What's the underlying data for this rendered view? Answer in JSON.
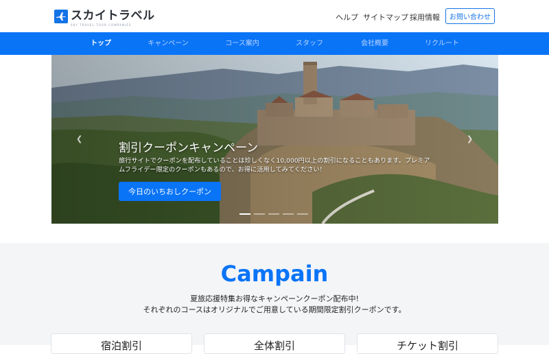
{
  "header": {
    "logo_text": "スカイトラベル",
    "logo_sub": "SKY TRAVEL TOUR COMPANIES",
    "nav": [
      "ヘルプ",
      "サイトマップ",
      "採用情報"
    ],
    "contact_label": "お問い合わせ"
  },
  "gnav": {
    "items": [
      "トップ",
      "キャンペーン",
      "コース案内",
      "スタッフ",
      "会社概要",
      "リクルート"
    ],
    "active": "トップ"
  },
  "hero": {
    "title": "割引クーポンキャンペーン",
    "description": "旅行サイトでクーポンを配布していることは珍しくなく10,000円以上の割引になることもあります。プレミアムフライデー限定のクーポンもあるので、お得に活用してみてください！",
    "button_label": "今日のいちおしクーポン",
    "prev_icon": "chevron-left-icon",
    "next_icon": "chevron-right-icon",
    "slides": 5,
    "active_slide": 1
  },
  "campaign": {
    "title": "Campain",
    "line1": "夏旅応援特集お得なキャンペーンクーポン配布中!",
    "line2": "それぞれのコースはオリジナルでご用意している期間限定割引クーポンです。",
    "cards": [
      "宿泊割引",
      "全体割引",
      "チケット割引"
    ]
  },
  "colors": {
    "accent": "#0a74f7",
    "nav_inactive": "#b9d4ff",
    "section_bg": "#f4f5f7"
  }
}
